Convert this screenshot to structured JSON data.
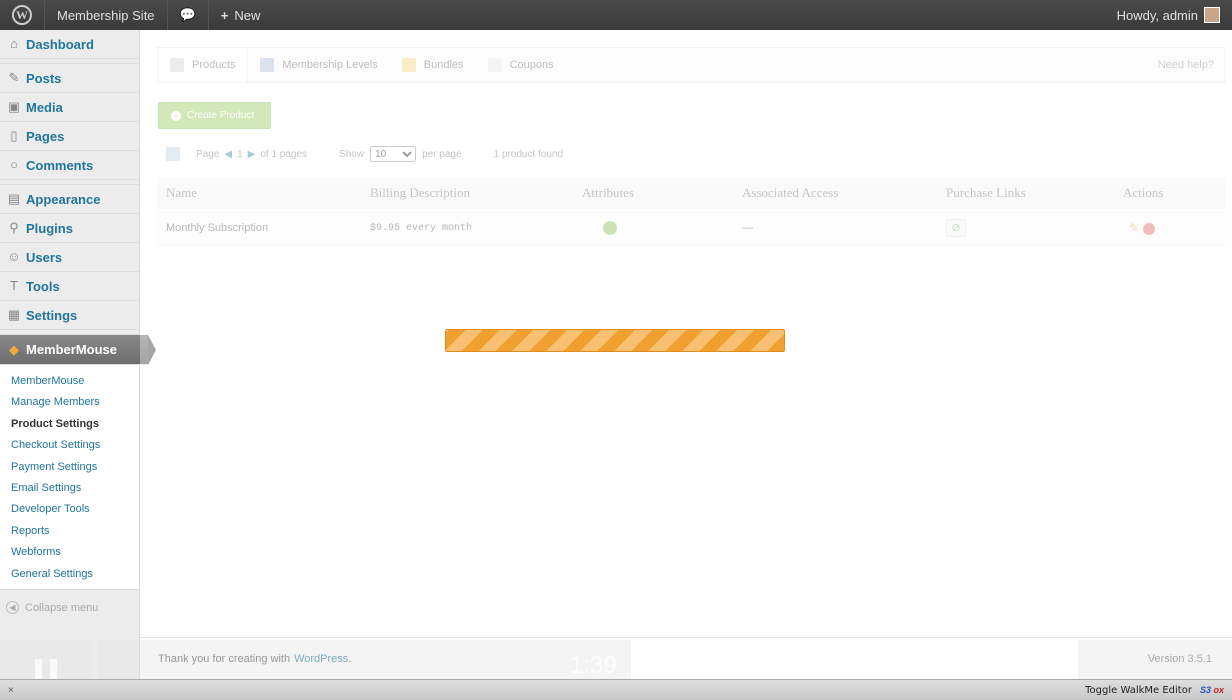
{
  "adminbar": {
    "site_name": "Membership Site",
    "new_label": "New",
    "howdy": "Howdy, admin"
  },
  "sidebar": {
    "items": [
      {
        "label": "Dashboard",
        "icon": "house-icon"
      },
      {
        "label": "Posts",
        "icon": "pin-icon"
      },
      {
        "label": "Media",
        "icon": "media-icon"
      },
      {
        "label": "Pages",
        "icon": "page-icon"
      },
      {
        "label": "Comments",
        "icon": "comment-icon"
      },
      {
        "label": "Appearance",
        "icon": "appearance-icon"
      },
      {
        "label": "Plugins",
        "icon": "plugin-icon"
      },
      {
        "label": "Users",
        "icon": "users-icon"
      },
      {
        "label": "Tools",
        "icon": "tools-icon"
      },
      {
        "label": "Settings",
        "icon": "settings-icon"
      },
      {
        "label": "MemberMouse",
        "icon": "membermouse-icon"
      }
    ],
    "submenu": [
      "MemberMouse",
      "Manage Members",
      "Product Settings",
      "Checkout Settings",
      "Payment Settings",
      "Email Settings",
      "Developer Tools",
      "Reports",
      "Webforms",
      "General Settings"
    ],
    "collapse_label": "Collapse menu"
  },
  "tabs": [
    "Products",
    "Membership Levels",
    "Bundles",
    "Coupons"
  ],
  "need_help": "Need help?",
  "create_button": "Create Product",
  "pager": {
    "page_label": "Page",
    "page_number": "1",
    "of_pages": "of 1 pages",
    "show_label": "Show",
    "per_page_value": "10",
    "per_page_label": "per page",
    "found": "1 product found"
  },
  "table": {
    "headers": [
      "Name",
      "Billing Description",
      "Attributes",
      "Associated Access",
      "Purchase Links",
      "Actions"
    ],
    "rows": [
      {
        "name": "Monthly Subscription",
        "billing": "$9.95 every month",
        "access": "—"
      }
    ]
  },
  "footer": {
    "thanks": "Thank you for creating with",
    "wp_link": "WordPress",
    "version": "Version 3.5.1"
  },
  "video": {
    "time": "1:39"
  },
  "statusbar": {
    "close": "×",
    "toggle": "Toggle WalkMe Editor",
    "badge_a": "S3",
    "badge_b": "ox"
  },
  "colors": {
    "link": "#21759b",
    "progress": "#f0a030",
    "create_button": "#8bc34a"
  }
}
